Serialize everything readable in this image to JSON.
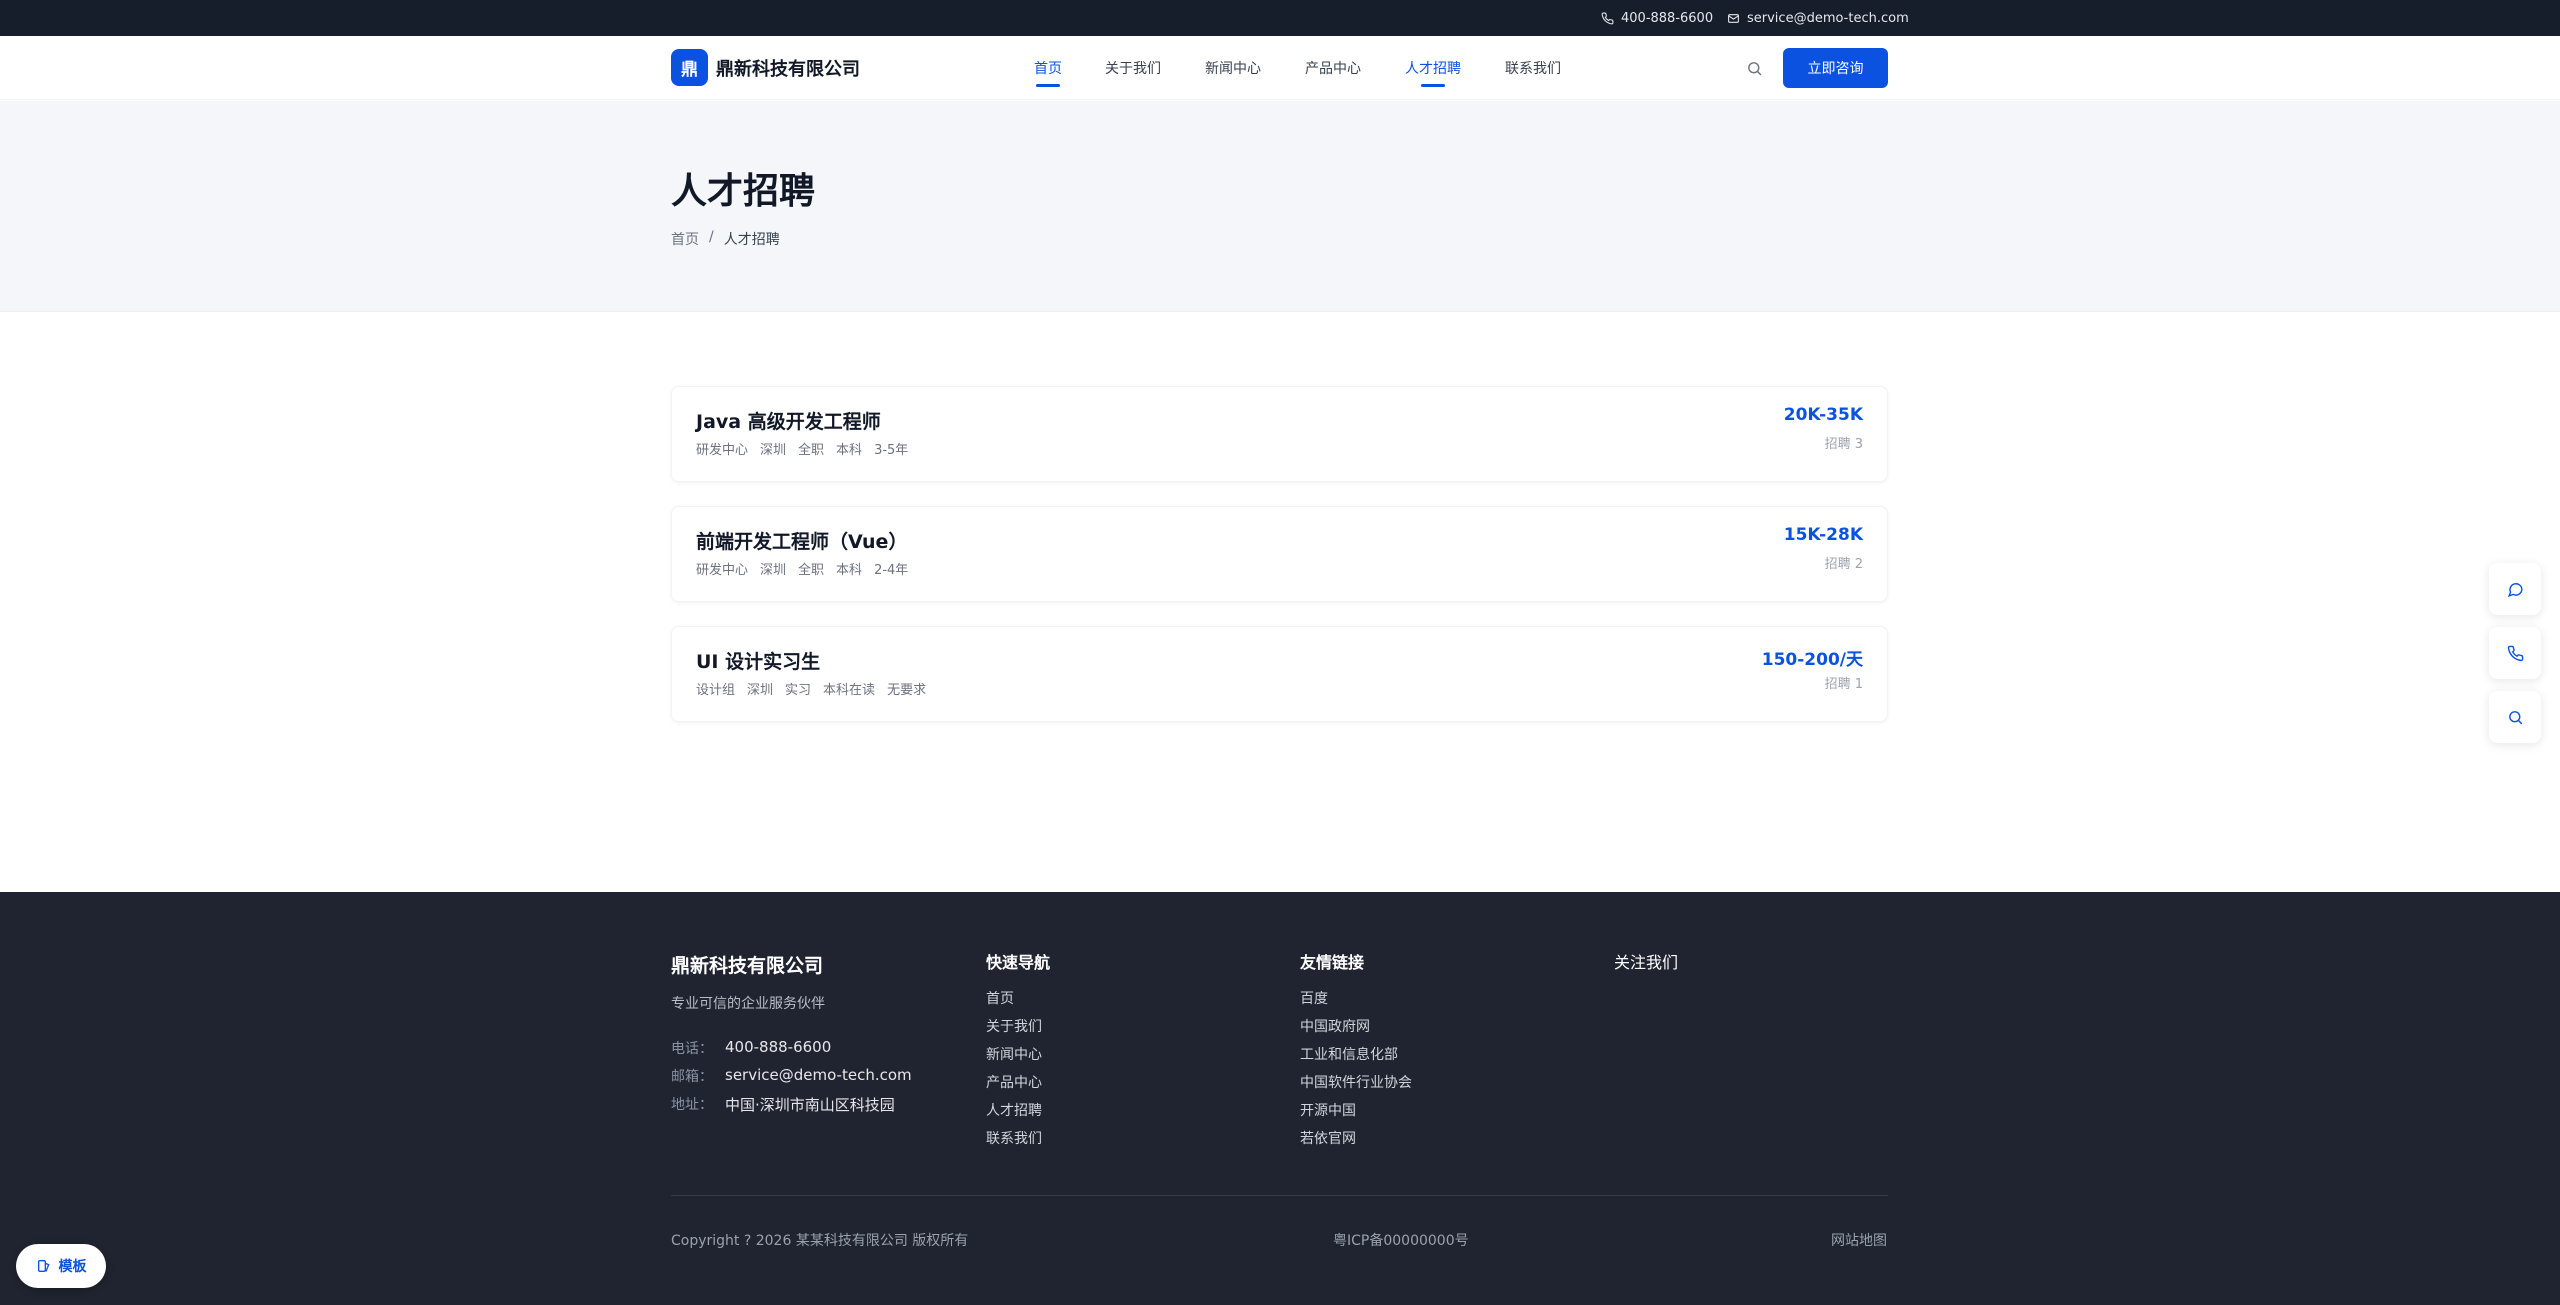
{
  "topbar": {
    "phone": "400-888-6600",
    "email": "service@demo-tech.com"
  },
  "header": {
    "logo_mark": "鼎",
    "company_name": "鼎新科技有限公司",
    "nav": [
      {
        "label": "首页",
        "active": true
      },
      {
        "label": "关于我们",
        "active": false
      },
      {
        "label": "新闻中心",
        "active": false
      },
      {
        "label": "产品中心",
        "active": false
      },
      {
        "label": "人才招聘",
        "active": true
      },
      {
        "label": "联系我们",
        "active": false
      }
    ],
    "search_icon": "search-icon",
    "cta_label": "立即咨询"
  },
  "banner": {
    "title": "人才招聘",
    "breadcrumb": {
      "home": "首页",
      "separator": "/",
      "current": "人才招聘"
    }
  },
  "jobs": [
    {
      "title": "Java 高级开发工程师",
      "tags": [
        "研发中心",
        "深圳",
        "全职",
        "本科",
        "3-5年"
      ],
      "salary": "20K-35K",
      "count": "招聘 3"
    },
    {
      "title": "前端开发工程师（Vue）",
      "tags": [
        "研发中心",
        "深圳",
        "全职",
        "本科",
        "2-4年"
      ],
      "salary": "15K-28K",
      "count": "招聘 2"
    },
    {
      "title": "UI 设计实习生",
      "tags": [
        "设计组",
        "深圳",
        "实习",
        "本科在读",
        "无要求"
      ],
      "salary": "150-200/天",
      "count": "招聘 1"
    }
  ],
  "float_buttons": [
    "chat-icon",
    "phone-icon",
    "search-icon"
  ],
  "footer": {
    "brand": "鼎新科技有限公司",
    "slogan": "专业可信的企业服务伙伴",
    "contact": [
      {
        "key": "电话：",
        "value": "400-888-6600"
      },
      {
        "key": "邮箱：",
        "value": "service@demo-tech.com"
      },
      {
        "key": "地址：",
        "value": "中国·深圳市南山区科技园"
      }
    ],
    "quick_nav": {
      "heading": "快速导航",
      "links": [
        "首页",
        "关于我们",
        "新闻中心",
        "产品中心",
        "人才招聘",
        "联系我们"
      ]
    },
    "friend_links": {
      "heading": "友情链接",
      "links": [
        "百度",
        "中国政府网",
        "工业和信息化部",
        "中国软件行业协会",
        "开源中国",
        "若依官网"
      ]
    },
    "follow": {
      "heading": "关注我们"
    },
    "copyright": "Copyright ? 2026 某某科技有限公司 版权所有",
    "icp": "粤ICP备00000000号",
    "sitemap": "网站地图"
  },
  "template_badge": "模板",
  "colors": {
    "accent": "#0b52e0",
    "topbar_bg": "#161d2b",
    "footer_bg": "#1f2430",
    "banner_bg": "#f4f6f9"
  }
}
